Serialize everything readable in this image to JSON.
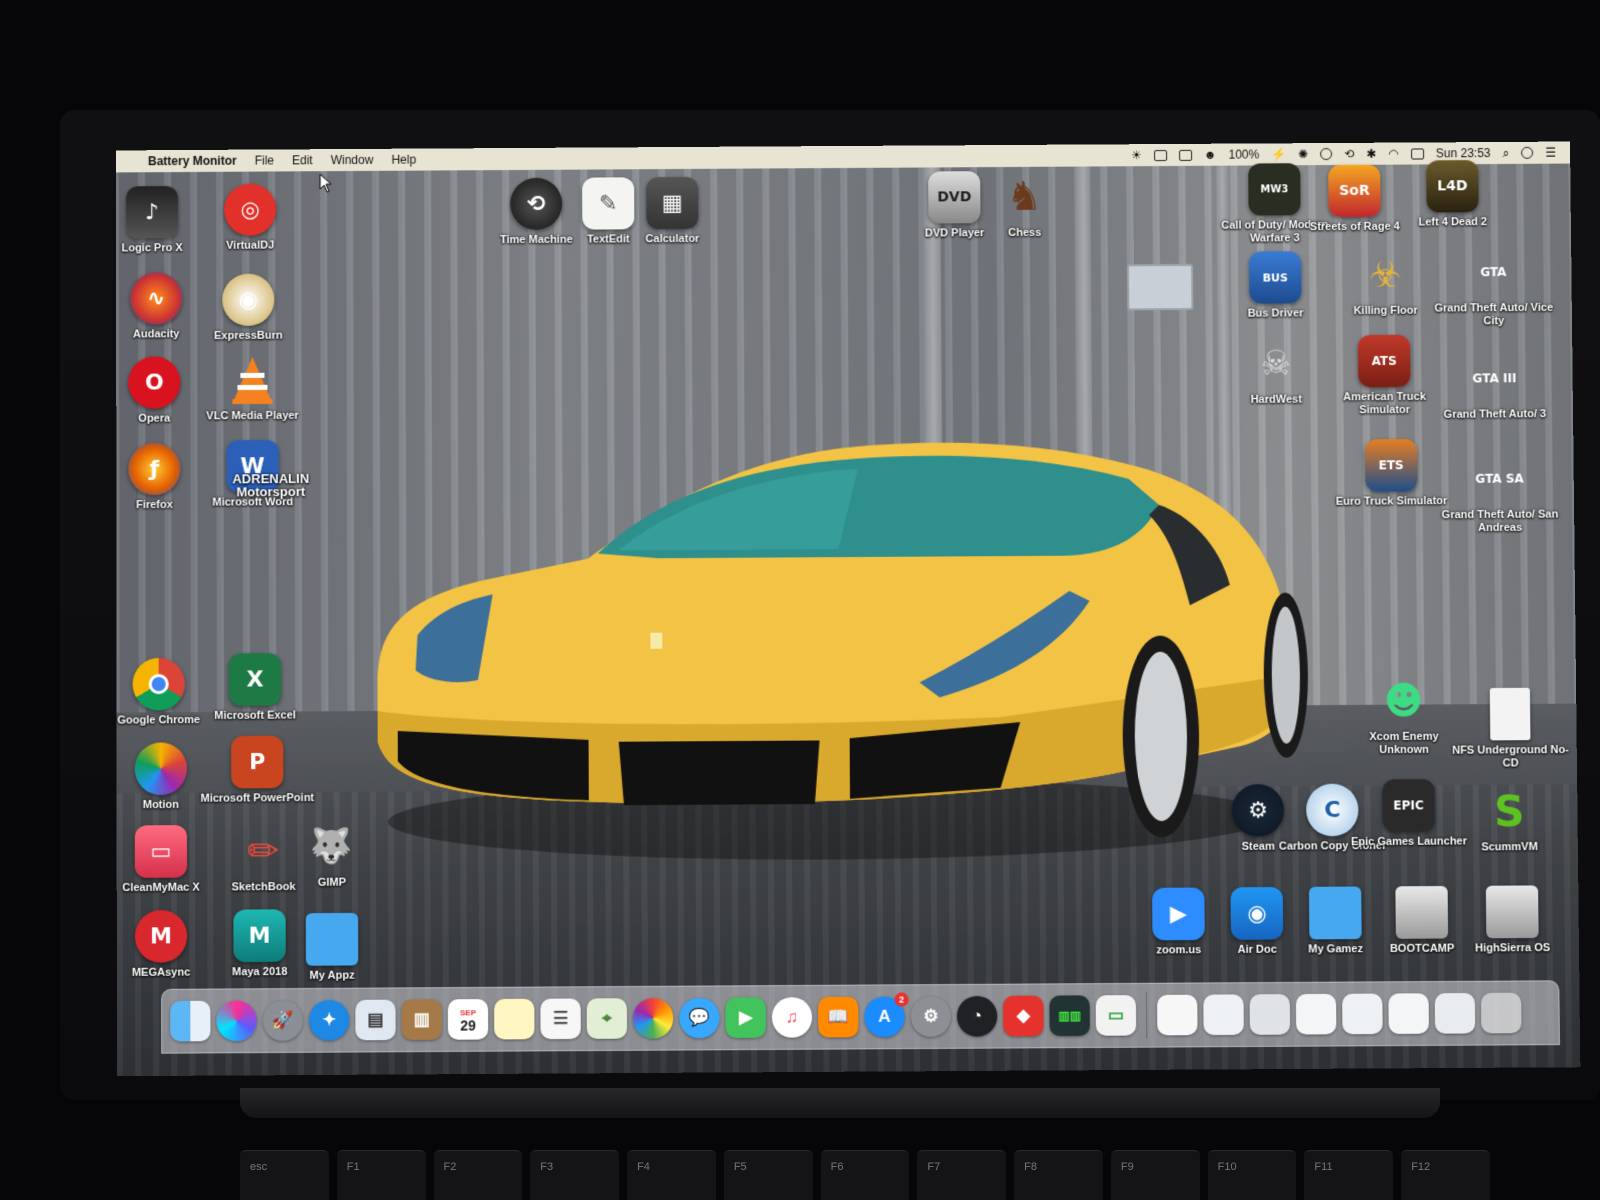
{
  "menubar": {
    "app_name": "Battery Monitor",
    "menus": [
      "File",
      "Edit",
      "Window",
      "Help"
    ],
    "battery_percent": "100%",
    "clock": "Sun 23:53"
  },
  "desktop_icons": {
    "logic_pro": "Logic Pro X",
    "virtualdj": "VirtualDJ",
    "audacity": "Audacity",
    "expressburn": "ExpressBurn",
    "opera": "Opera",
    "vlc": "VLC Media Player",
    "firefox": "Firefox",
    "word": "Microsoft Word",
    "adrenaline": "ADRENALIN Motorsport",
    "time_machine": "Time Machine",
    "textedit": "TextEdit",
    "calculator": "Calculator",
    "dvd_player": "DVD Player",
    "chess": "Chess",
    "cod_mw3": "Call of Duty/ Modern Warfare 3",
    "streets_of_rage": "Streets of Rage 4",
    "left4dead": "Left 4 Dead 2",
    "bus_driver": "Bus Driver",
    "killing_floor": "Killing Floor",
    "gta_vc": "Grand Theft Auto/ Vice City",
    "hardwest": "HardWest",
    "ats": "American Truck Simulator",
    "gta3": "Grand Theft Auto/ 3",
    "ets": "Euro Truck Simulator",
    "gta_sa": "Grand Theft Auto/ San Andreas",
    "chrome": "Google Chrome",
    "excel": "Microsoft Excel",
    "motion": "Motion",
    "powerpoint": "Microsoft PowerPoint",
    "cleanmymac": "CleanMyMac X",
    "sketchbook": "SketchBook",
    "gimp": "GIMP",
    "megasync": "MEGAsync",
    "maya": "Maya 2018",
    "my_appz": "My Appz",
    "xcom": "Xcom Enemy Unknown",
    "nfs": "NFS Underground No-CD",
    "steam": "Steam",
    "ccc": "Carbon Copy Cloner",
    "epic": "Epic Games Launcher",
    "scummvm": "ScummVM",
    "zoom": "zoom.us",
    "airdoc": "Air Doc",
    "my_gamez": "My Gamez",
    "bootcamp": "BOOTCAMP",
    "highsierra": "HighSierra OS"
  },
  "dock": {
    "calendar_day": "29",
    "calendar_month": "SEP",
    "appstore_badge": "2"
  },
  "keyboard": {
    "keys": [
      "esc",
      "F1",
      "F2",
      "F3",
      "F4",
      "F5",
      "F6",
      "F7",
      "F8",
      "F9",
      "F10",
      "F11",
      "F12"
    ]
  },
  "colors": {
    "car": "#f2c344",
    "menubar": "#ece8d7",
    "folder": "#46a9ef"
  }
}
